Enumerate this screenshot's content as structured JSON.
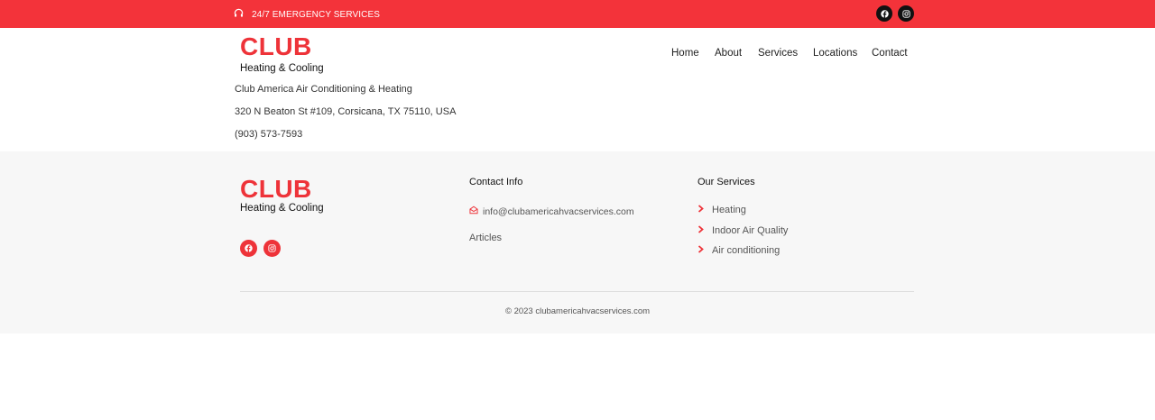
{
  "topbar": {
    "emergency_text": "24/7 EMERGENCY SERVICES",
    "icon": "headphones-icon",
    "social": [
      "facebook-icon",
      "instagram-icon"
    ],
    "bg_color": "#f3333a"
  },
  "header": {
    "logo_title": "CLUB",
    "logo_subtitle": "Heating & Cooling",
    "nav": [
      "Home",
      "About",
      "Services",
      "Locations",
      "Contact"
    ]
  },
  "business": {
    "name": "Club America Air Conditioning & Heating",
    "address": "320 N Beaton St #109, Corsicana, TX 75110, USA",
    "phone": "(903) 573-7593"
  },
  "footer": {
    "logo_title": "CLUB",
    "logo_subtitle": "Heating & Cooling",
    "social": [
      "facebook-icon",
      "instagram-icon"
    ],
    "contact_heading": "Contact Info",
    "email": "info@clubamericahvacservices.com",
    "articles_link": "Articles",
    "services_heading": "Our Services",
    "services": [
      "Heating",
      "Indoor Air Quality",
      "Air conditioning"
    ],
    "copyright": "© 2023 clubamericahvacservices.com"
  },
  "colors": {
    "accent": "#ee3339",
    "footer_bg": "#f7f7f7"
  }
}
